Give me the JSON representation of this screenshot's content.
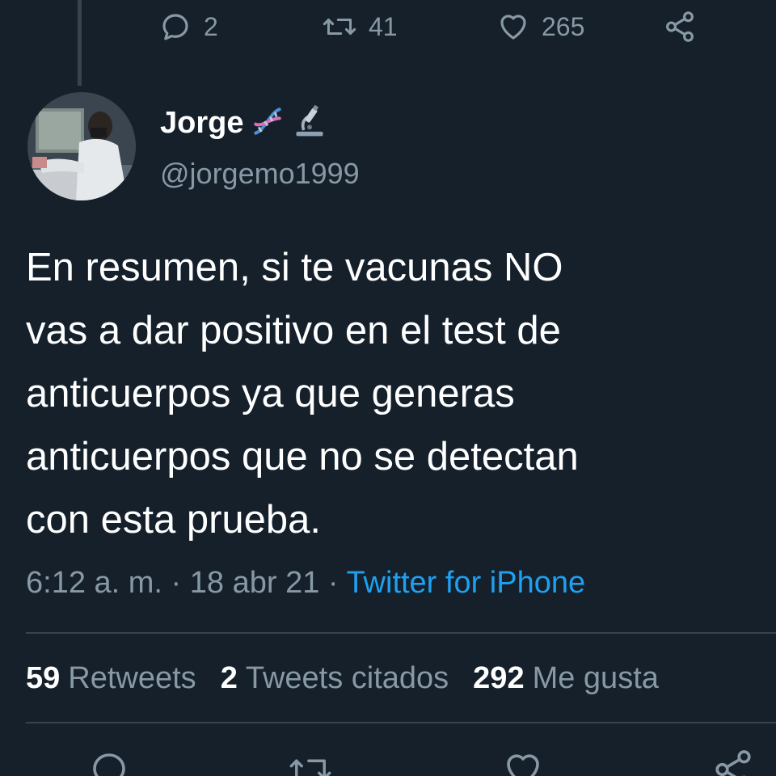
{
  "previous_tweet": {
    "reply_count": "2",
    "retweet_count": "41",
    "like_count": "265"
  },
  "author": {
    "name": "Jorge",
    "handle": "@jorgemo1999",
    "name_emojis": [
      "dna-emoji",
      "microscope-emoji"
    ]
  },
  "tweet": {
    "text": "En resumen, si te vacunas NO\nvas a dar positivo en el test de\nanticuerpos ya que generas\nanticuerpos que no se detectan\ncon esta prueba.",
    "time": "6:12 a. m.",
    "separator": "·",
    "date": "18 abr 21",
    "source": "Twitter for iPhone"
  },
  "stats": {
    "retweets_count": "59",
    "retweets_label": "Retweets",
    "quotes_count": "2",
    "quotes_label": "Tweets citados",
    "likes_count": "292",
    "likes_label": "Me gusta"
  },
  "colors": {
    "background": "#15202b",
    "text": "#ffffff",
    "secondary": "#8899a6",
    "accent": "#1da1f2",
    "divider": "#38444d"
  }
}
